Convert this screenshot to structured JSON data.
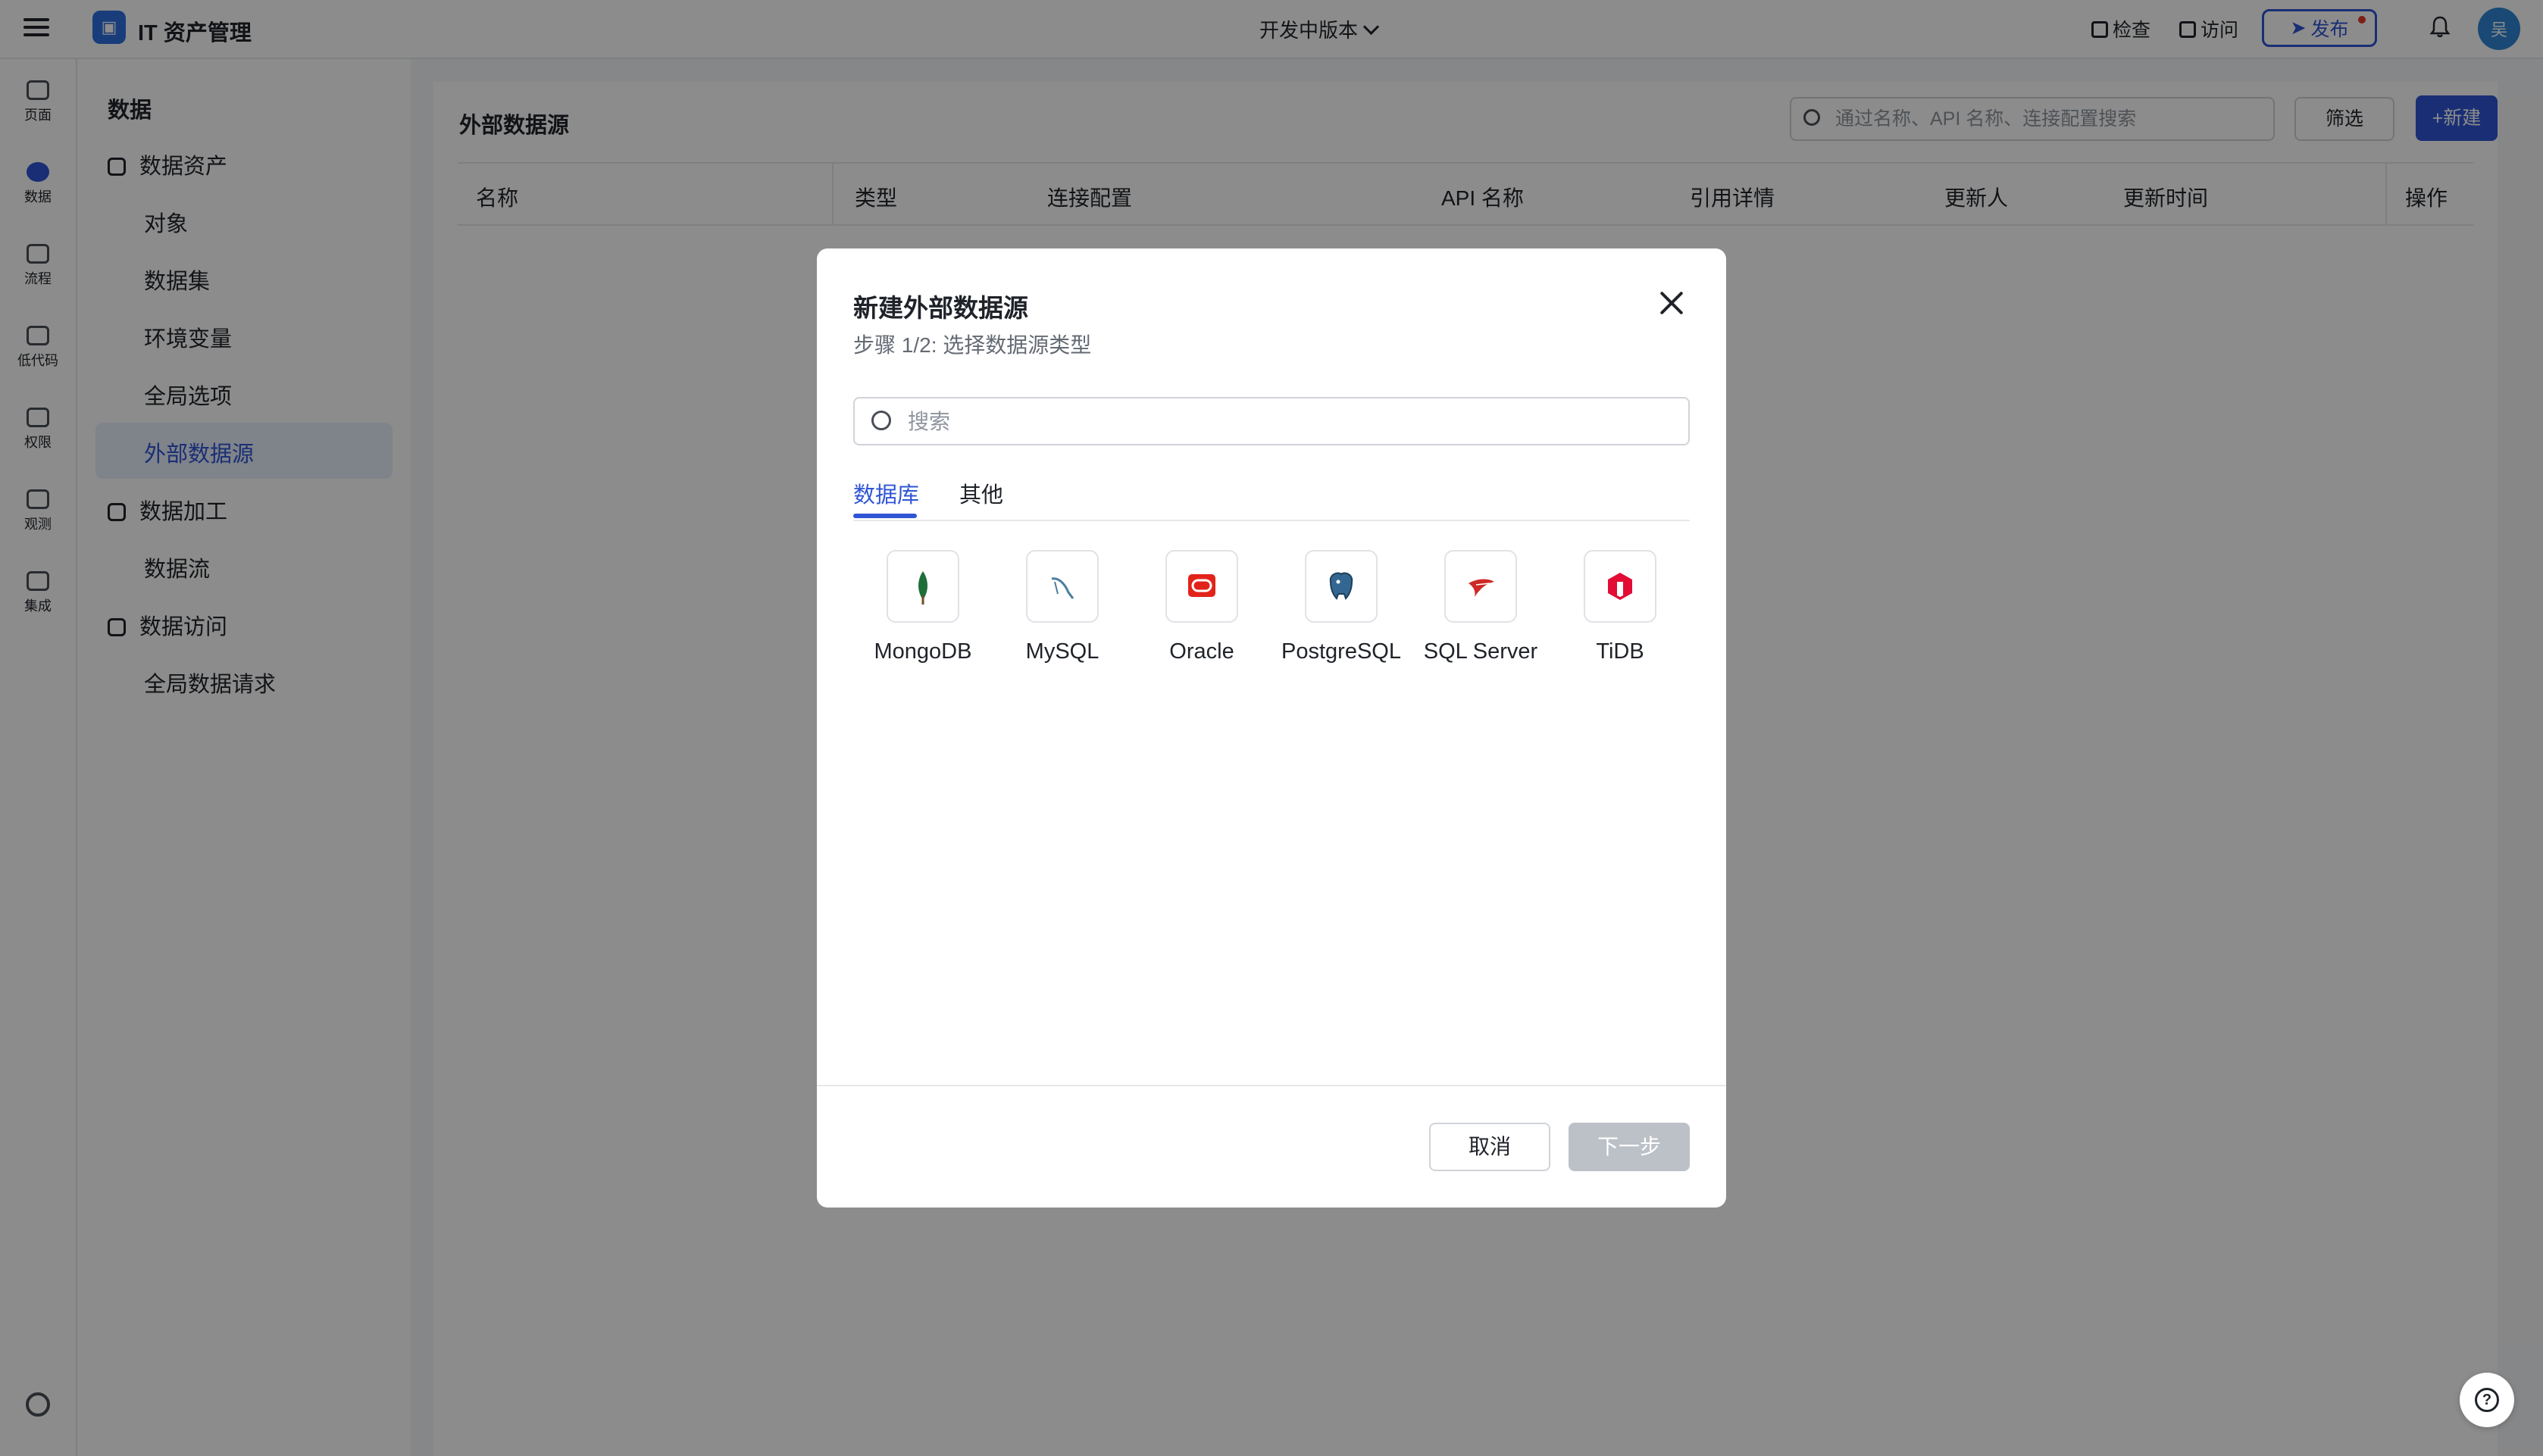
{
  "topbar": {
    "app_title": "IT 资产管理",
    "version": "开发中版本",
    "inspect": "检查",
    "visit": "访问",
    "publish": "发布",
    "avatar_text": "吴"
  },
  "rail": {
    "items": [
      {
        "label": "页面",
        "icon": "page-icon"
      },
      {
        "label": "数据",
        "icon": "database-icon"
      },
      {
        "label": "流程",
        "icon": "flow-icon"
      },
      {
        "label": "低代码",
        "icon": "code-icon"
      },
      {
        "label": "权限",
        "icon": "lock-icon"
      },
      {
        "label": "观测",
        "icon": "observe-icon"
      },
      {
        "label": "集成",
        "icon": "integration-icon"
      }
    ]
  },
  "nav": {
    "title": "数据",
    "groups": [
      {
        "label": "数据资产",
        "items": [
          "对象",
          "数据集",
          "环境变量",
          "全局选项",
          "外部数据源"
        ]
      },
      {
        "label": "数据加工",
        "items": [
          "数据流"
        ]
      },
      {
        "label": "数据访问",
        "items": [
          "全局数据请求"
        ]
      }
    ]
  },
  "main": {
    "title": "外部数据源",
    "search_placeholder": "通过名称、API 名称、连接配置搜索",
    "filter": "筛选",
    "new": "新建",
    "columns": [
      "名称",
      "类型",
      "连接配置",
      "API 名称",
      "引用详情",
      "更新人",
      "更新时间",
      "操作"
    ]
  },
  "modal": {
    "title": "新建外部数据源",
    "subtitle": "步骤 1/2: 选择数据源类型",
    "search_placeholder": "搜索",
    "tabs": [
      "数据库",
      "其他"
    ],
    "databases": [
      "MongoDB",
      "MySQL",
      "Oracle",
      "PostgreSQL",
      "SQL Server",
      "TiDB"
    ],
    "cancel": "取消",
    "next": "下一步"
  },
  "colors": {
    "accent": "#2f55d4",
    "overlay": "rgba(0,0,0,0.45)"
  }
}
